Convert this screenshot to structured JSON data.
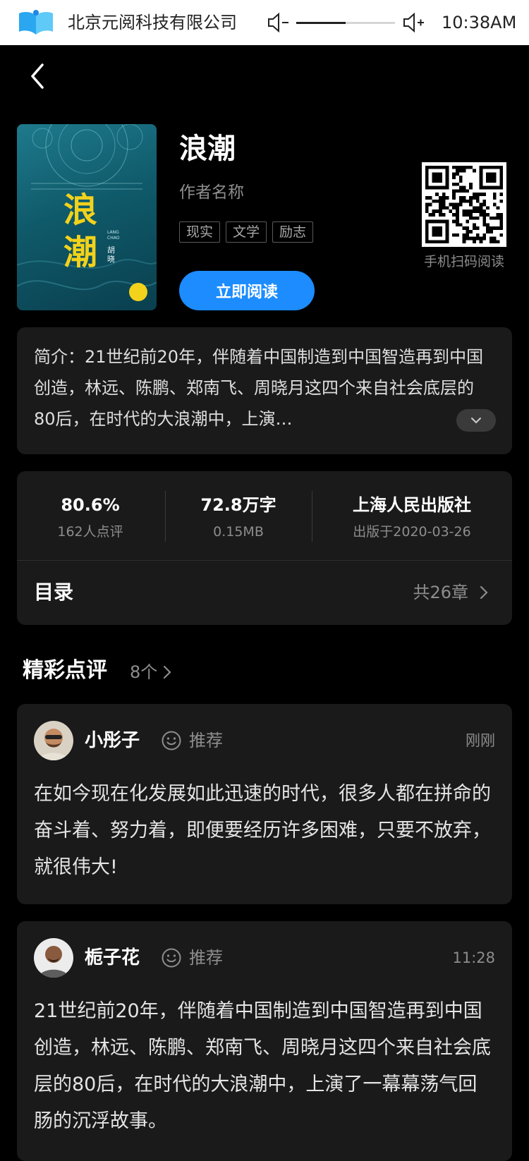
{
  "status_bar": {
    "company": "北京元阅科技有限公司",
    "volume_level": 0.5,
    "time": "10:38AM",
    "colors": {
      "bar": "#ffffff",
      "text": "#222222"
    }
  },
  "book": {
    "title": "浪潮",
    "author": "作者名称",
    "tags": [
      "现实",
      "文学",
      "励志"
    ],
    "read_button": "立即阅读",
    "qr_label": "手机扫码阅读",
    "cover_title": "浪潮",
    "cover_author": "胡晓",
    "cover_pinyin": "LANG CHAO"
  },
  "intro": {
    "text": "简介：21世纪前20年，伴随着中国制造到中国智造再到中国创造，林远、陈鹏、郑南飞、周晓月这四个来自社会底层的80后，在时代的大浪潮中，上演…"
  },
  "stats": {
    "rating": {
      "value": "80.6%",
      "sub": "162人点评"
    },
    "words": {
      "value": "72.8万字",
      "sub": "0.15MB"
    },
    "publisher": {
      "value": "上海人民出版社",
      "sub": "出版于2020-03-26"
    }
  },
  "toc": {
    "label": "目录",
    "count": "共26章"
  },
  "reviews": {
    "title": "精彩点评",
    "count": "8个",
    "items": [
      {
        "name": "小彤子",
        "tag": "推荐",
        "time": "刚刚",
        "text": "在如今现在化发展如此迅速的时代，很多人都在拼命的奋斗着、努力着，即便要经历许多困难，只要不放弃，就很伟大!"
      },
      {
        "name": "栀子花",
        "tag": "推荐",
        "time": "11:28",
        "text": "21世纪前20年，伴随着中国制造到中国智造再到中国创造，林远、陈鹏、郑南飞、周晓月这四个来自社会底层的80后，在时代的大浪潮中，上演了一幕幕荡气回肠的沉浮故事。"
      }
    ]
  },
  "colors": {
    "background": "#000000",
    "card": "#1a1a1a",
    "accent": "#1c8cff",
    "muted": "#8d8d8d",
    "cover_title": "#f2d21b"
  }
}
